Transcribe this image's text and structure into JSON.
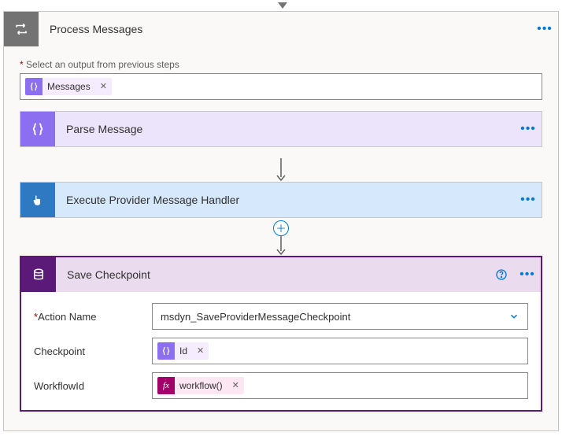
{
  "outer": {
    "title": "Process Messages",
    "icon_bg": "#737373"
  },
  "output_section": {
    "label_prefix": "*",
    "label": "Select an output from previous steps",
    "token": {
      "label": "Messages"
    }
  },
  "steps": {
    "parse": {
      "title": "Parse Message",
      "hd_bg": "#ece4fb",
      "icon_bg": "#8c6ff0"
    },
    "execute": {
      "title": "Execute Provider Message Handler",
      "hd_bg": "#d6e8fb",
      "icon_bg": "#2f79c3"
    },
    "save": {
      "title": "Save Checkpoint",
      "hd_bg": "#eadbee",
      "icon_bg": "#5b1978",
      "rows": {
        "action": {
          "label": "Action Name",
          "required": true,
          "value": "msdyn_SaveProviderMessageCheckpoint"
        },
        "checkpoint": {
          "label": "Checkpoint",
          "token": "Id"
        },
        "workflow": {
          "label": "WorkflowId",
          "token": "workflow()"
        }
      }
    }
  }
}
